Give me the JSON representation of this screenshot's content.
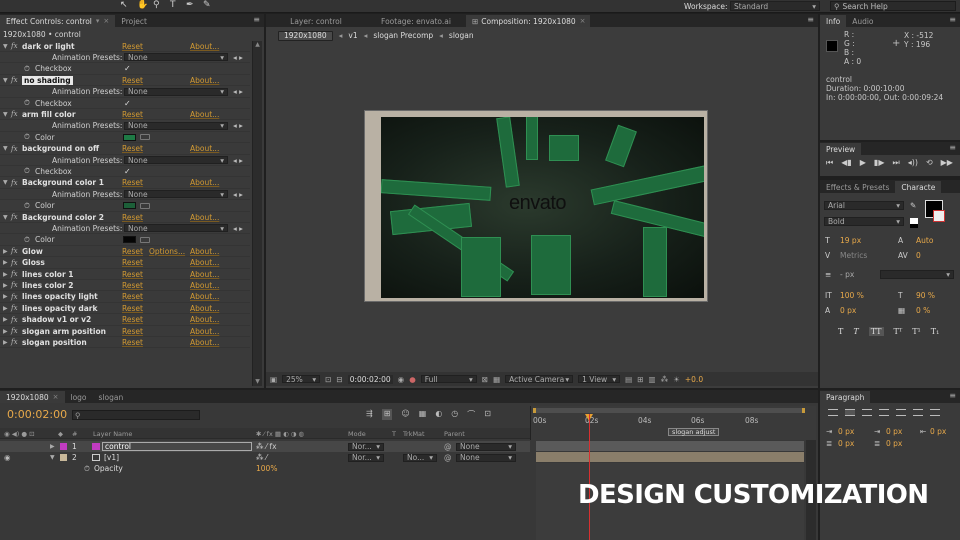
{
  "toolbar": {
    "workspace_label": "Workspace:",
    "workspace_value": "Standard",
    "search_placeholder": "Search Help"
  },
  "effect_controls": {
    "tab_label": "Effect Controls: control",
    "project_tab": "Project",
    "title": "1920x1080 • control",
    "effects": [
      {
        "name": "dark or light",
        "reset": "Reset",
        "about": "About...",
        "presets_label": "Animation Presets:",
        "presets_value": "None",
        "prop_label": "Checkbox",
        "prop_kind": "checkbox"
      },
      {
        "name": "no shading",
        "reset": "Reset",
        "about": "About...",
        "presets_label": "Animation Presets:",
        "presets_value": "None",
        "prop_label": "Checkbox",
        "prop_kind": "checkbox"
      },
      {
        "name": "arm fill color",
        "reset": "Reset",
        "about": "About...",
        "presets_label": "Animation Presets:",
        "presets_value": "None",
        "prop_label": "Color",
        "prop_kind": "color",
        "color": "#1e7a45"
      },
      {
        "name": "background on off",
        "reset": "Reset",
        "about": "About...",
        "presets_label": "Animation Presets:",
        "presets_value": "None",
        "prop_label": "Checkbox",
        "prop_kind": "checkbox"
      },
      {
        "name": "Background color 1",
        "reset": "Reset",
        "about": "About...",
        "presets_label": "Animation Presets:",
        "presets_value": "None",
        "prop_label": "Color",
        "prop_kind": "color",
        "color": "#1c5f38"
      },
      {
        "name": "Background color 2",
        "reset": "Reset",
        "about": "About...",
        "presets_label": "Animation Presets:",
        "presets_value": "None",
        "prop_label": "Color",
        "prop_kind": "color",
        "color": "#050505"
      }
    ],
    "collapsed": [
      {
        "name": "Glow",
        "reset": "Reset",
        "options": "Options...",
        "about": "About..."
      },
      {
        "name": "Gloss",
        "reset": "Reset",
        "about": "About..."
      },
      {
        "name": "lines color 1",
        "reset": "Reset",
        "about": "About..."
      },
      {
        "name": "lines color 2",
        "reset": "Reset",
        "about": "About..."
      },
      {
        "name": "lines opacity light",
        "reset": "Reset",
        "about": "About..."
      },
      {
        "name": "lines opacity dark",
        "reset": "Reset",
        "about": "About..."
      },
      {
        "name": "shadow v1 or v2",
        "reset": "Reset",
        "about": "About..."
      },
      {
        "name": "slogan arm position",
        "reset": "Reset",
        "about": "About..."
      },
      {
        "name": "slogan position",
        "reset": "Reset",
        "about": "About..."
      }
    ]
  },
  "viewer": {
    "tabs": [
      {
        "label": "Layer: control"
      },
      {
        "label": "Footage: envato.ai"
      },
      {
        "label": "Composition: 1920x1080"
      }
    ],
    "breadcrumbs": [
      "1920x1080",
      "v1",
      "slogan Precomp",
      "slogan"
    ],
    "logo_text": "envato",
    "footer": {
      "zoom": "25%",
      "timecode": "0:00:02:00",
      "resolution": "Full",
      "camera": "Active Camera",
      "view": "1 View",
      "exposure": "+0.0"
    }
  },
  "info": {
    "tab": "Info",
    "audio_tab": "Audio",
    "r": "R :",
    "g": "G :",
    "b": "B :",
    "a": "A : 0",
    "x": "X : -512",
    "y": "Y : 196",
    "layer": "control",
    "duration": "Duration: 0:00:10:00",
    "inout": "In: 0:00:00:00, Out: 0:00:09:24"
  },
  "preview": {
    "tab": "Preview"
  },
  "character": {
    "tab1": "Effects & Presets",
    "tab2": "Characte",
    "font": "Arial",
    "style": "Bold",
    "size": "19 px",
    "leading": "Auto",
    "kerning": "Metrics",
    "tracking": "0",
    "stroke": "- px",
    "vscale": "100 %",
    "hscale": "90 %",
    "baseline": "0 px",
    "tsume": "0 %",
    "buttons": [
      "T",
      "T",
      "TT",
      "Tᵀ",
      "T¹",
      "T₁"
    ]
  },
  "paragraph": {
    "tab": "Paragraph",
    "indent_left": "0 px",
    "indent_first": "0 px",
    "indent_right": "0 px",
    "space_before": "0 px",
    "space_after": "0 px"
  },
  "timeline": {
    "tabs": [
      "1920x1080",
      "logo",
      "slogan"
    ],
    "timecode": "0:00:02:00",
    "columns": {
      "layer_name": "Layer Name",
      "mode": "Mode",
      "t": "T",
      "trkmat": "TrkMat",
      "parent": "Parent"
    },
    "ruler": [
      "00s",
      "02s",
      "04s",
      "06s",
      "08s"
    ],
    "marker": "slogan adjust",
    "layers": [
      {
        "num": "1",
        "name": "control",
        "mode": "Nor...",
        "trkmat": "",
        "parent": "None",
        "color": "#c23cc2"
      },
      {
        "num": "2",
        "name": "[v1]",
        "mode": "Nor...",
        "trkmat": "No...",
        "parent": "None",
        "color": "#c8b89a"
      }
    ],
    "property": {
      "name": "Opacity",
      "value": "100%"
    }
  },
  "overlay": {
    "caption": "DESIGN CUSTOMIZATION"
  }
}
